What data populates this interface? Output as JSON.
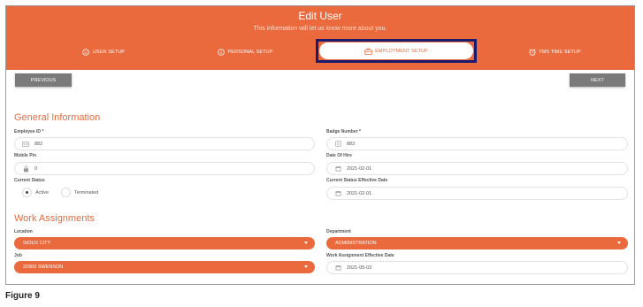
{
  "header": {
    "title": "Edit User",
    "subtitle": "This information will let us know more about you.",
    "color": "#ea6a3d"
  },
  "tabs": [
    {
      "label": "USER SETUP",
      "icon": "smiley-icon"
    },
    {
      "label": "PERSONAL SETUP",
      "icon": "info-icon"
    },
    {
      "label": "EMPLOYMENT SETUP",
      "icon": "briefcase-icon",
      "active": true
    },
    {
      "label": "TMS TIME SETUP",
      "icon": "alarm-clock-icon"
    }
  ],
  "nav": {
    "previous": "PREVIOUS",
    "next": "NEXT"
  },
  "general": {
    "title": "General Information",
    "employee_id": {
      "label": "Employee ID *",
      "value": "882",
      "icon": "id-card-icon"
    },
    "badge_number": {
      "label": "Badge Number *",
      "value": "882",
      "icon": "badge-icon"
    },
    "mobile_pin": {
      "label": "Mobile Pin",
      "value": "0",
      "icon": "lock-icon"
    },
    "date_of_hire": {
      "label": "Date Of Hire",
      "value": "2021-02-01",
      "icon": "calendar-icon"
    },
    "current_status": {
      "label": "Current Status",
      "options": [
        "Active",
        "Terminated"
      ],
      "selected": "Active"
    },
    "status_effective": {
      "label": "Current Status Effective Date",
      "value": "2021-02-01",
      "icon": "calendar-icon"
    }
  },
  "work": {
    "title": "Work Assignments",
    "location": {
      "label": "Location",
      "value": "SIOUX CITY"
    },
    "department": {
      "label": "Department",
      "value": "ADMINISTRATION"
    },
    "job": {
      "label": "Job",
      "value": "20900 SWENSON"
    },
    "assignment_effective": {
      "label": "Work Assignment Effective Date",
      "value": "2021-05-03",
      "icon": "calendar-icon"
    }
  },
  "caption": "Figure 9"
}
